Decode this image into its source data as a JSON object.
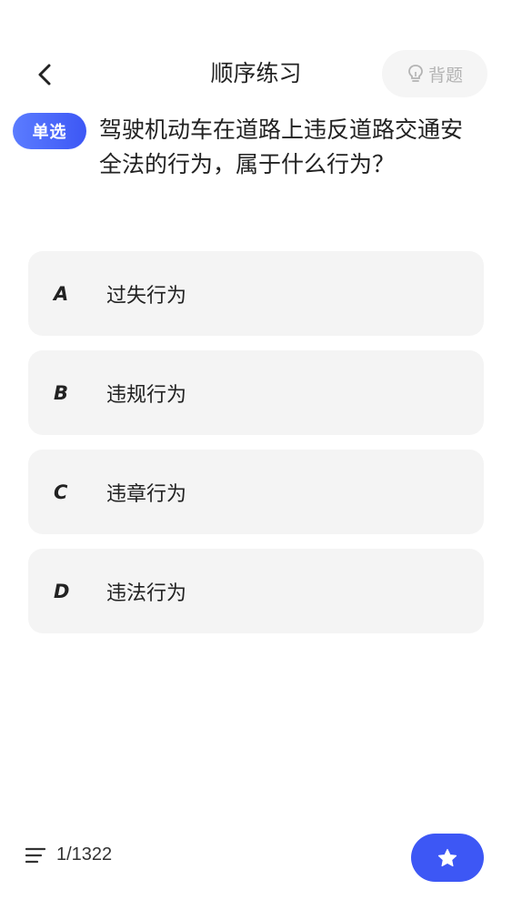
{
  "header": {
    "title": "顺序练习",
    "back_icon": "chevron-left-icon",
    "hint_icon": "lightbulb-icon",
    "hint_label": "背题"
  },
  "question": {
    "type_badge": "单选",
    "text": "驾驶机动车在道路上违反道路交通安全法的行为，属于什么行为？"
  },
  "options": [
    {
      "letter": "A",
      "text": "过失行为"
    },
    {
      "letter": "B",
      "text": "违规行为"
    },
    {
      "letter": "C",
      "text": "违章行为"
    },
    {
      "letter": "D",
      "text": "违法行为"
    }
  ],
  "footer": {
    "list_icon": "menu-list-icon",
    "progress": "1/1322",
    "favorite_icon": "star-icon"
  },
  "colors": {
    "accent": "#3d57f5",
    "option_bg": "#f4f4f4",
    "hint_bg": "#f5f5f5"
  }
}
